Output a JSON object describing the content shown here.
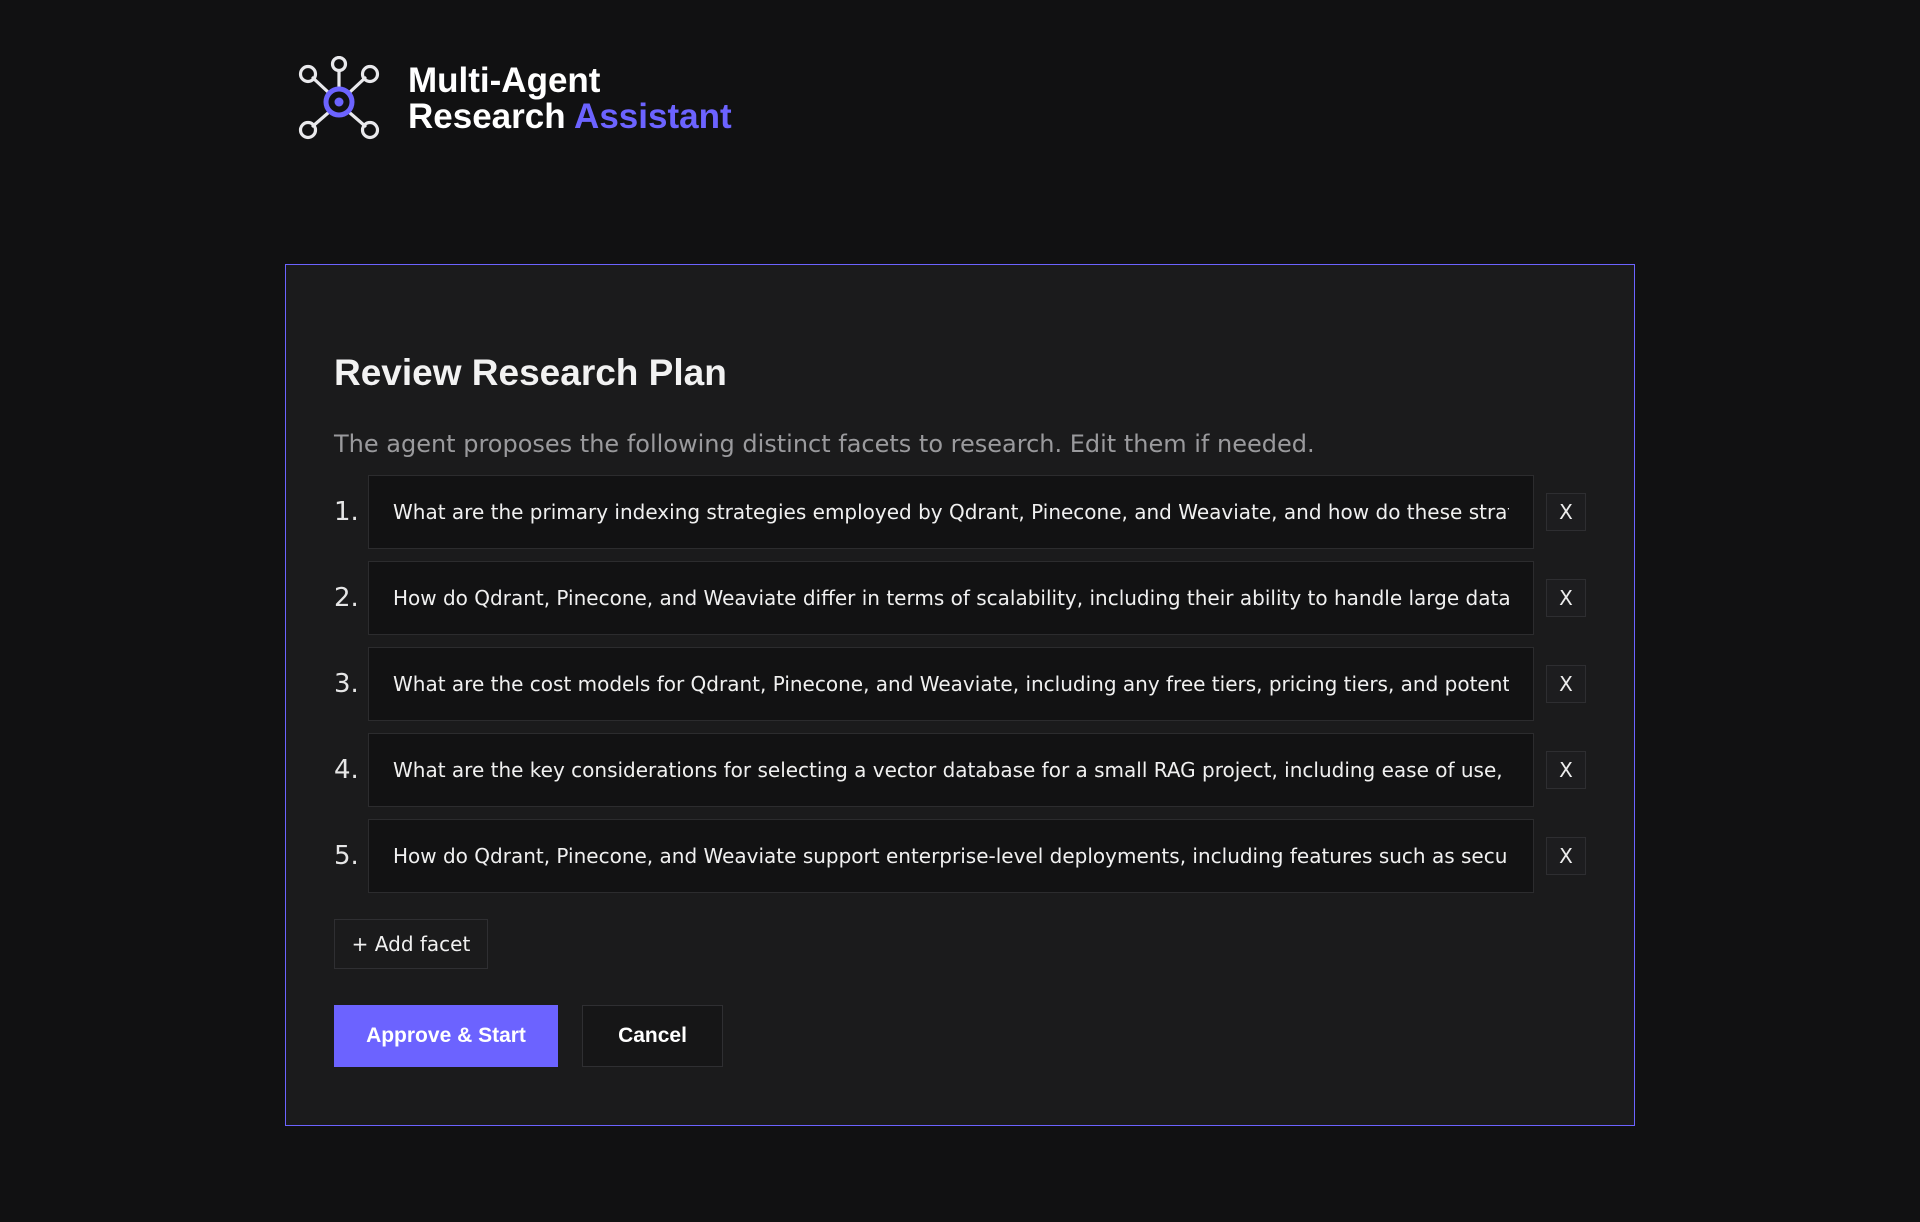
{
  "app": {
    "title_line1": "Multi-Agent",
    "title_line2_prefix": "Research",
    "title_line2_accent": "Assistant",
    "logo_icon": "network-hub-icon",
    "accent_color": "#6c63ff"
  },
  "plan": {
    "title": "Review Research Plan",
    "subtitle": "The agent proposes the following distinct facets to research. Edit them if needed.",
    "facets": [
      {
        "number": "1.",
        "value": "What are the primary indexing strategies employed by Qdrant, Pinecone, and Weaviate, and how do these strategies im",
        "remove_label": "X"
      },
      {
        "number": "2.",
        "value": "How do Qdrant, Pinecone, and Weaviate differ in terms of scalability, including their ability to handle large datasets, su",
        "remove_label": "X"
      },
      {
        "number": "3.",
        "value": "What are the cost models for Qdrant, Pinecone, and Weaviate, including any free tiers, pricing tiers, and potential costs",
        "remove_label": "X"
      },
      {
        "number": "4.",
        "value": "What are the key considerations for selecting a vector database for a small RAG project, including ease of use, develop",
        "remove_label": "X"
      },
      {
        "number": "5.",
        "value": "How do Qdrant, Pinecone, and Weaviate support enterprise-level deployments, including features such as security, reli",
        "remove_label": "X"
      }
    ],
    "add_label": "+ Add facet",
    "approve_label": "Approve & Start",
    "cancel_label": "Cancel"
  }
}
